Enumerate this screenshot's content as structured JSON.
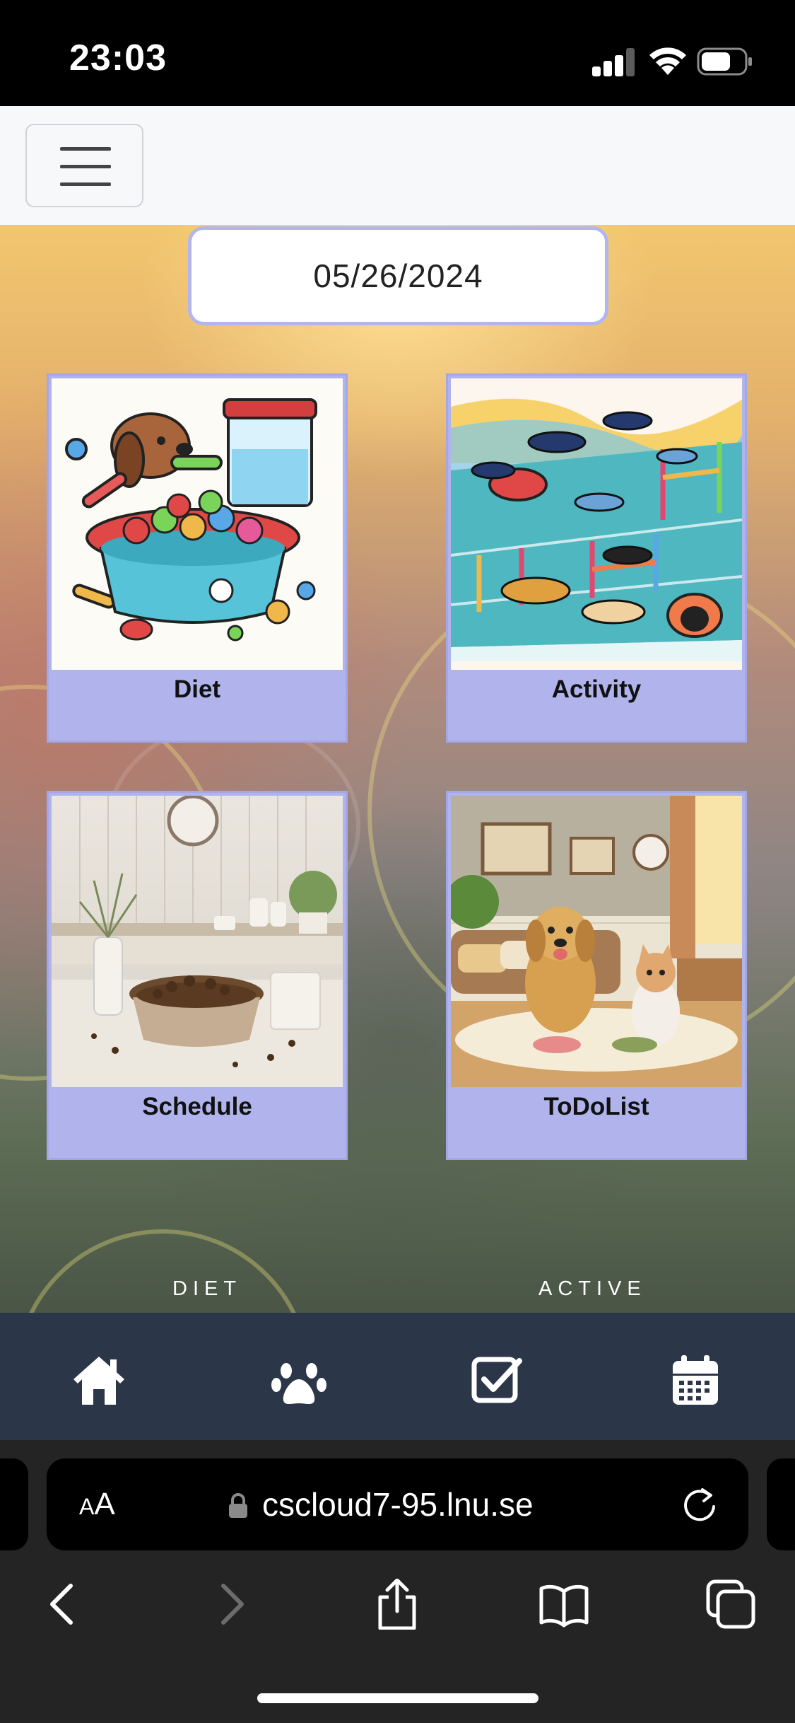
{
  "status_bar": {
    "time": "23:03",
    "icons": [
      "cellular-signal-icon",
      "wifi-icon",
      "battery-icon"
    ]
  },
  "header": {
    "menu_icon": "hamburger-menu-icon"
  },
  "main": {
    "date": "05/26/2024",
    "cards": [
      {
        "title": "Diet",
        "image": "dog-food-bowl-illustration"
      },
      {
        "title": "Activity",
        "image": "dog-agility-course-illustration"
      },
      {
        "title": "Schedule",
        "image": "food-bowl-kitchen-photo"
      },
      {
        "title": "ToDoList",
        "image": "dog-and-cat-living-room-illustration"
      }
    ],
    "footer_labels": [
      "DIET",
      "ACTIVE"
    ]
  },
  "tabbar": {
    "tabs": [
      {
        "icon": "home-icon"
      },
      {
        "icon": "paw-icon"
      },
      {
        "icon": "checkbox-icon"
      },
      {
        "icon": "calendar-icon"
      }
    ]
  },
  "browser": {
    "text_size_label_small": "A",
    "text_size_label_large": "A",
    "url": "cscloud7-95.lnu.se",
    "icons": [
      "lock-icon",
      "reload-icon",
      "back-icon",
      "forward-icon",
      "share-icon",
      "bookmarks-icon",
      "tabs-icon"
    ]
  },
  "colors": {
    "card_background": "#b1b4ec",
    "tabbar_background": "#2b3648",
    "header_background": "#f7f8fa",
    "browser_background": "#242424"
  }
}
